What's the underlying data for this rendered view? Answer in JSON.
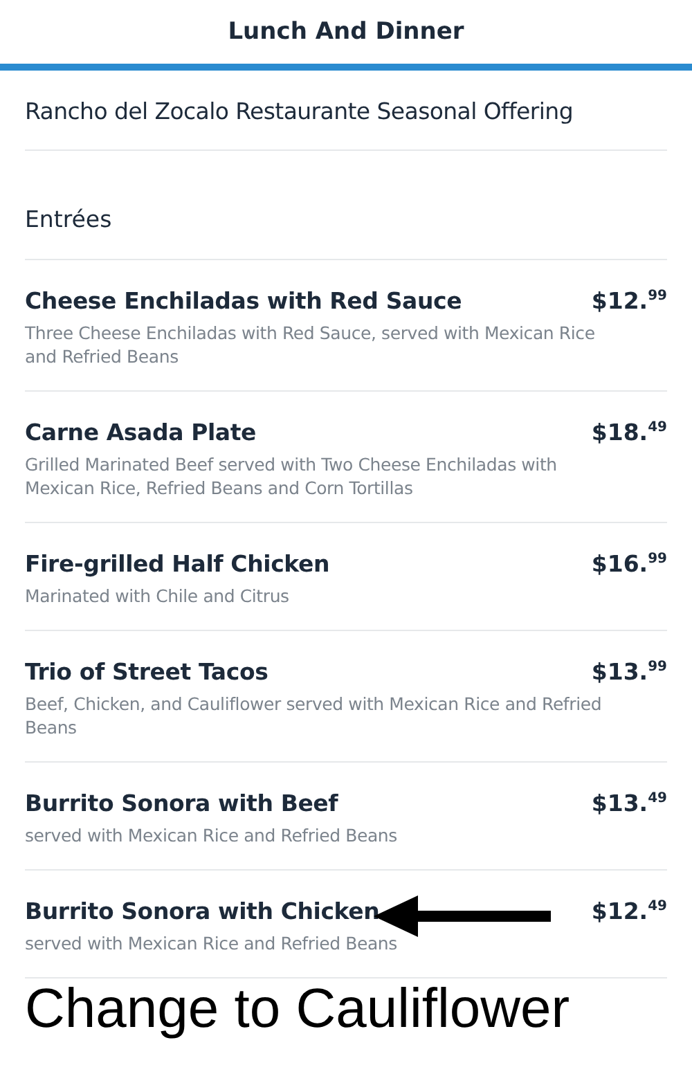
{
  "header": {
    "title": "Lunch And Dinner"
  },
  "menu_title": "Rancho del Zocalo Restaurante Seasonal Offering",
  "section": "Entrées",
  "items": [
    {
      "name": "Cheese Enchiladas with Red Sauce",
      "price": "$12.$^{99}$",
      "description": "Three Cheese Enchiladas with Red Sauce, served with Mexican Rice and Refried Beans"
    },
    {
      "name": "Carne Asada Plate",
      "price": "$18.$^{49}$",
      "description": "Grilled Marinated Beef served with Two Cheese Enchiladas with Mexican Rice, Refried Beans and Corn Tortillas"
    },
    {
      "name": "Fire-grilled Half Chicken",
      "price": "$16.$^{99}$",
      "description": "Marinated with Chile and Citrus"
    },
    {
      "name": "Trio of Street Tacos",
      "price": "$13.$^{99}$",
      "description": "Beef, Chicken, and Cauliflower served with Mexican Rice and Refried Beans"
    },
    {
      "name": "Burrito Sonora with Beef",
      "price": "$13.$^{49}$",
      "description": "served with Mexican Rice and Refried Beans"
    },
    {
      "name": "Burrito Sonora with Chicken",
      "price": "$12.$^{49}$",
      "description": "served with Mexican Rice and Refried Beans",
      "annotated": true
    }
  ],
  "annotation": {
    "text": "Change to Cauliflower"
  }
}
